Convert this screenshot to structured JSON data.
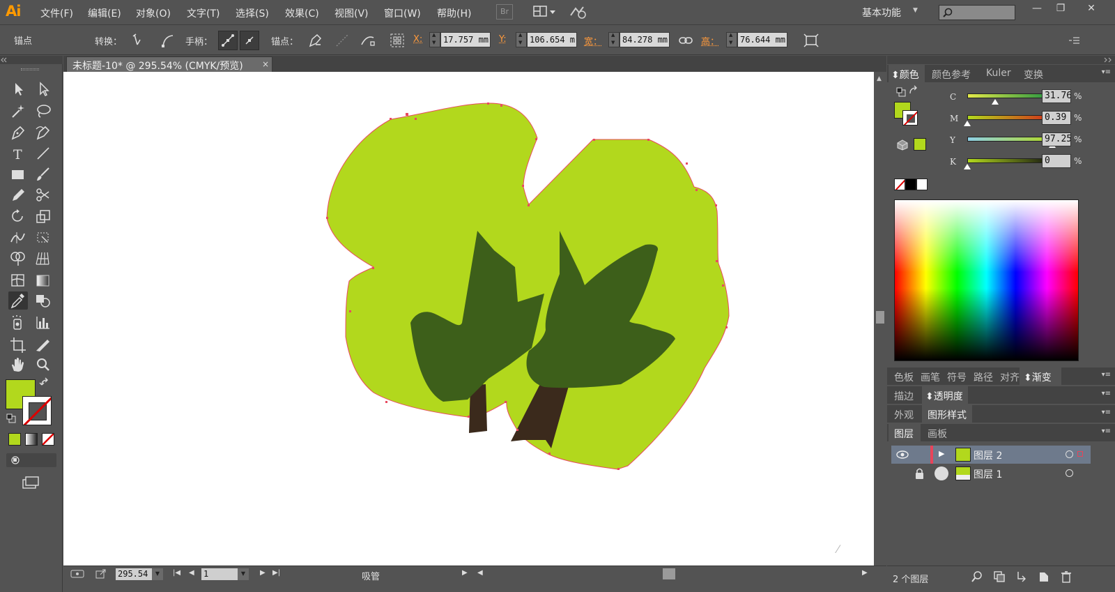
{
  "app": {
    "logo": "Ai",
    "menus": [
      "文件(F)",
      "编辑(E)",
      "对象(O)",
      "文字(T)",
      "选择(S)",
      "效果(C)",
      "视图(V)",
      "窗口(W)",
      "帮助(H)"
    ],
    "bridge_label": "Br",
    "workspace": "基本功能",
    "search_placeholder": ""
  },
  "control_bar": {
    "tool_name": "锚点",
    "convert_label": "转换：",
    "handles_label": "手柄：",
    "anchors_label": "锚点：",
    "x_label": "X:",
    "x_value": "17.757 mm",
    "y_label": "Y:",
    "y_value": "106.654 m",
    "width_label": "宽：",
    "width_value": "84.278 mm",
    "height_label": "高：",
    "height_value": "76.644 mm"
  },
  "document": {
    "tab_title": "未标题-10* @ 295.54% (CMYK/预览)",
    "close_glyph": "×"
  },
  "status_bar": {
    "zoom": "295.54",
    "page": "1",
    "current_tool": "吸管"
  },
  "color_panel": {
    "tabs": [
      "颜色",
      "颜色参考",
      "Kuler",
      "变换"
    ],
    "active_tab": "颜色",
    "fill_color": "#b2d81d",
    "channels": [
      {
        "letter": "C",
        "value": "31.76",
        "fraction": 0.3176
      },
      {
        "letter": "M",
        "value": "0.39",
        "fraction": 0.0039
      },
      {
        "letter": "Y",
        "value": "97.25",
        "fraction": 0.9725
      },
      {
        "letter": "K",
        "value": "0",
        "fraction": 0
      }
    ],
    "percent_sign": "%"
  },
  "swatch_panel_tabs": [
    "色板",
    "画笔",
    "符号",
    "路径",
    "对齐",
    "渐变"
  ],
  "stroke_tabs": [
    "描边",
    "透明度"
  ],
  "appearance_tabs": [
    "外观",
    "图形样式"
  ],
  "layers_panel": {
    "tabs": [
      "图层",
      "画板"
    ],
    "layers": [
      {
        "name": "图层 2",
        "selected": true
      },
      {
        "name": "图层 1",
        "selected": false
      }
    ],
    "count_label": "2 个图层"
  },
  "colors": {
    "fill_green": "#b2d81d",
    "dark_leaf": "#3d5f1a",
    "trunk": "#3b2a1c",
    "path_outline": "#e84a5f",
    "selection_layer": "#e8445a"
  }
}
